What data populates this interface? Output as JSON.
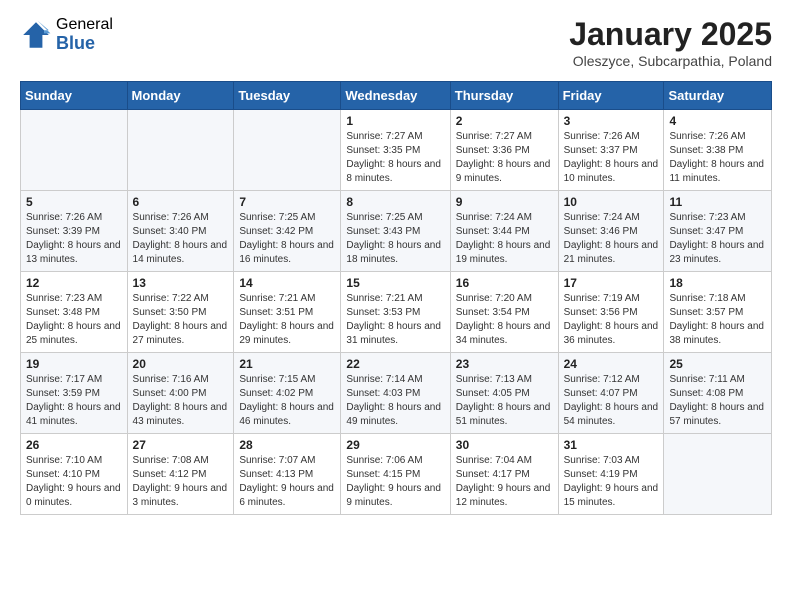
{
  "logo": {
    "general": "General",
    "blue": "Blue"
  },
  "header": {
    "title": "January 2025",
    "subtitle": "Oleszyce, Subcarpathia, Poland"
  },
  "days_of_week": [
    "Sunday",
    "Monday",
    "Tuesday",
    "Wednesday",
    "Thursday",
    "Friday",
    "Saturday"
  ],
  "weeks": [
    [
      {
        "day": "",
        "info": ""
      },
      {
        "day": "",
        "info": ""
      },
      {
        "day": "",
        "info": ""
      },
      {
        "day": "1",
        "info": "Sunrise: 7:27 AM\nSunset: 3:35 PM\nDaylight: 8 hours and 8 minutes."
      },
      {
        "day": "2",
        "info": "Sunrise: 7:27 AM\nSunset: 3:36 PM\nDaylight: 8 hours and 9 minutes."
      },
      {
        "day": "3",
        "info": "Sunrise: 7:26 AM\nSunset: 3:37 PM\nDaylight: 8 hours and 10 minutes."
      },
      {
        "day": "4",
        "info": "Sunrise: 7:26 AM\nSunset: 3:38 PM\nDaylight: 8 hours and 11 minutes."
      }
    ],
    [
      {
        "day": "5",
        "info": "Sunrise: 7:26 AM\nSunset: 3:39 PM\nDaylight: 8 hours and 13 minutes."
      },
      {
        "day": "6",
        "info": "Sunrise: 7:26 AM\nSunset: 3:40 PM\nDaylight: 8 hours and 14 minutes."
      },
      {
        "day": "7",
        "info": "Sunrise: 7:25 AM\nSunset: 3:42 PM\nDaylight: 8 hours and 16 minutes."
      },
      {
        "day": "8",
        "info": "Sunrise: 7:25 AM\nSunset: 3:43 PM\nDaylight: 8 hours and 18 minutes."
      },
      {
        "day": "9",
        "info": "Sunrise: 7:24 AM\nSunset: 3:44 PM\nDaylight: 8 hours and 19 minutes."
      },
      {
        "day": "10",
        "info": "Sunrise: 7:24 AM\nSunset: 3:46 PM\nDaylight: 8 hours and 21 minutes."
      },
      {
        "day": "11",
        "info": "Sunrise: 7:23 AM\nSunset: 3:47 PM\nDaylight: 8 hours and 23 minutes."
      }
    ],
    [
      {
        "day": "12",
        "info": "Sunrise: 7:23 AM\nSunset: 3:48 PM\nDaylight: 8 hours and 25 minutes."
      },
      {
        "day": "13",
        "info": "Sunrise: 7:22 AM\nSunset: 3:50 PM\nDaylight: 8 hours and 27 minutes."
      },
      {
        "day": "14",
        "info": "Sunrise: 7:21 AM\nSunset: 3:51 PM\nDaylight: 8 hours and 29 minutes."
      },
      {
        "day": "15",
        "info": "Sunrise: 7:21 AM\nSunset: 3:53 PM\nDaylight: 8 hours and 31 minutes."
      },
      {
        "day": "16",
        "info": "Sunrise: 7:20 AM\nSunset: 3:54 PM\nDaylight: 8 hours and 34 minutes."
      },
      {
        "day": "17",
        "info": "Sunrise: 7:19 AM\nSunset: 3:56 PM\nDaylight: 8 hours and 36 minutes."
      },
      {
        "day": "18",
        "info": "Sunrise: 7:18 AM\nSunset: 3:57 PM\nDaylight: 8 hours and 38 minutes."
      }
    ],
    [
      {
        "day": "19",
        "info": "Sunrise: 7:17 AM\nSunset: 3:59 PM\nDaylight: 8 hours and 41 minutes."
      },
      {
        "day": "20",
        "info": "Sunrise: 7:16 AM\nSunset: 4:00 PM\nDaylight: 8 hours and 43 minutes."
      },
      {
        "day": "21",
        "info": "Sunrise: 7:15 AM\nSunset: 4:02 PM\nDaylight: 8 hours and 46 minutes."
      },
      {
        "day": "22",
        "info": "Sunrise: 7:14 AM\nSunset: 4:03 PM\nDaylight: 8 hours and 49 minutes."
      },
      {
        "day": "23",
        "info": "Sunrise: 7:13 AM\nSunset: 4:05 PM\nDaylight: 8 hours and 51 minutes."
      },
      {
        "day": "24",
        "info": "Sunrise: 7:12 AM\nSunset: 4:07 PM\nDaylight: 8 hours and 54 minutes."
      },
      {
        "day": "25",
        "info": "Sunrise: 7:11 AM\nSunset: 4:08 PM\nDaylight: 8 hours and 57 minutes."
      }
    ],
    [
      {
        "day": "26",
        "info": "Sunrise: 7:10 AM\nSunset: 4:10 PM\nDaylight: 9 hours and 0 minutes."
      },
      {
        "day": "27",
        "info": "Sunrise: 7:08 AM\nSunset: 4:12 PM\nDaylight: 9 hours and 3 minutes."
      },
      {
        "day": "28",
        "info": "Sunrise: 7:07 AM\nSunset: 4:13 PM\nDaylight: 9 hours and 6 minutes."
      },
      {
        "day": "29",
        "info": "Sunrise: 7:06 AM\nSunset: 4:15 PM\nDaylight: 9 hours and 9 minutes."
      },
      {
        "day": "30",
        "info": "Sunrise: 7:04 AM\nSunset: 4:17 PM\nDaylight: 9 hours and 12 minutes."
      },
      {
        "day": "31",
        "info": "Sunrise: 7:03 AM\nSunset: 4:19 PM\nDaylight: 9 hours and 15 minutes."
      },
      {
        "day": "",
        "info": ""
      }
    ]
  ]
}
